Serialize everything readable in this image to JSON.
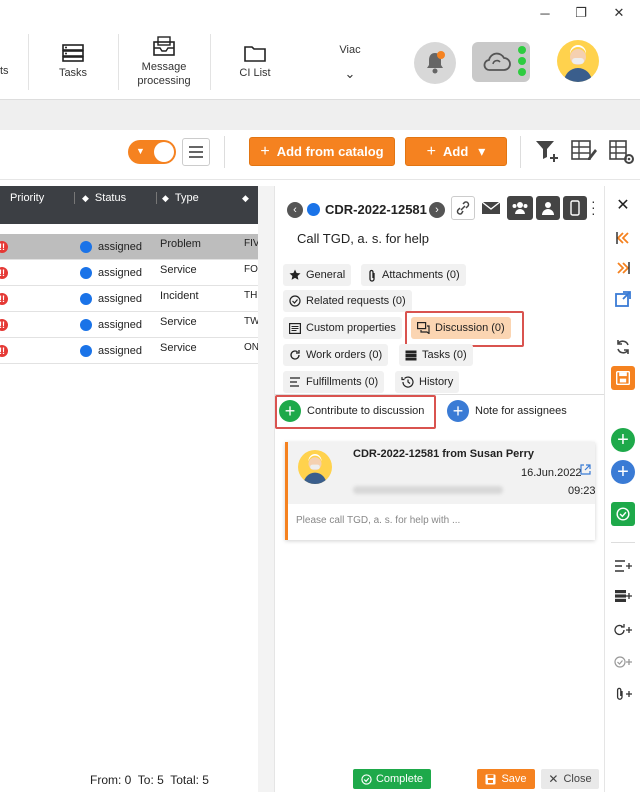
{
  "window": {
    "minimize": "─",
    "restore": "❐",
    "close": "✕"
  },
  "nav": {
    "partial_left": "ts",
    "items": [
      {
        "label": "Tasks",
        "icon": "server-stack-icon"
      },
      {
        "label": "Message processing",
        "icon": "message-inbox-icon"
      },
      {
        "label": "CI List",
        "icon": "folder-icon"
      }
    ],
    "user_label": "Viac",
    "user_chevron": "⌄"
  },
  "toolbar": {
    "add_from_catalog": "Add from catalog",
    "add": "Add",
    "plus": "+",
    "caret": "▾"
  },
  "grid": {
    "columns": [
      "Priority",
      "Status",
      "Type"
    ],
    "rows": [
      {
        "status": "assigned",
        "type": "Problem",
        "extra": "FIV",
        "selected": true
      },
      {
        "status": "assigned",
        "type": "Service",
        "extra": "FO",
        "selected": false
      },
      {
        "status": "assigned",
        "type": "Incident",
        "extra": "TH",
        "selected": false
      },
      {
        "status": "assigned",
        "type": "Service",
        "extra": "TW",
        "selected": false
      },
      {
        "status": "assigned",
        "type": "Service",
        "extra": "ON",
        "selected": false
      }
    ],
    "priority_glyph": "!!",
    "footer": "From: 0  To: 5  Total: 5"
  },
  "panel": {
    "request_id": "CDR-2022-12581",
    "title": "Call TGD, a. s. for help",
    "tabs": {
      "general": "General",
      "attachments": "Attachments (0)",
      "related": "Related requests (0)",
      "custom": "Custom properties",
      "discussion": "Discussion (0)",
      "work_orders": "Work orders (0)",
      "tasks": "Tasks (0)",
      "fulfillments": "Fulfillments (0)",
      "history": "History"
    },
    "contribute": "Contribute to discussion",
    "note": "Note for assignees",
    "card": {
      "heading": "CDR-2022-12581 from Susan Perry",
      "date": "16.Jun.2022",
      "time": "09:23",
      "message": "Please call TGD, a. s. for help with ..."
    },
    "footer": {
      "complete": "Complete",
      "save": "Save",
      "close": "Close"
    }
  },
  "colors": {
    "accent": "#f58220",
    "green": "#1ea94a",
    "blue": "#3a7bd5",
    "red": "#e53935",
    "header": "#3c3f44"
  }
}
